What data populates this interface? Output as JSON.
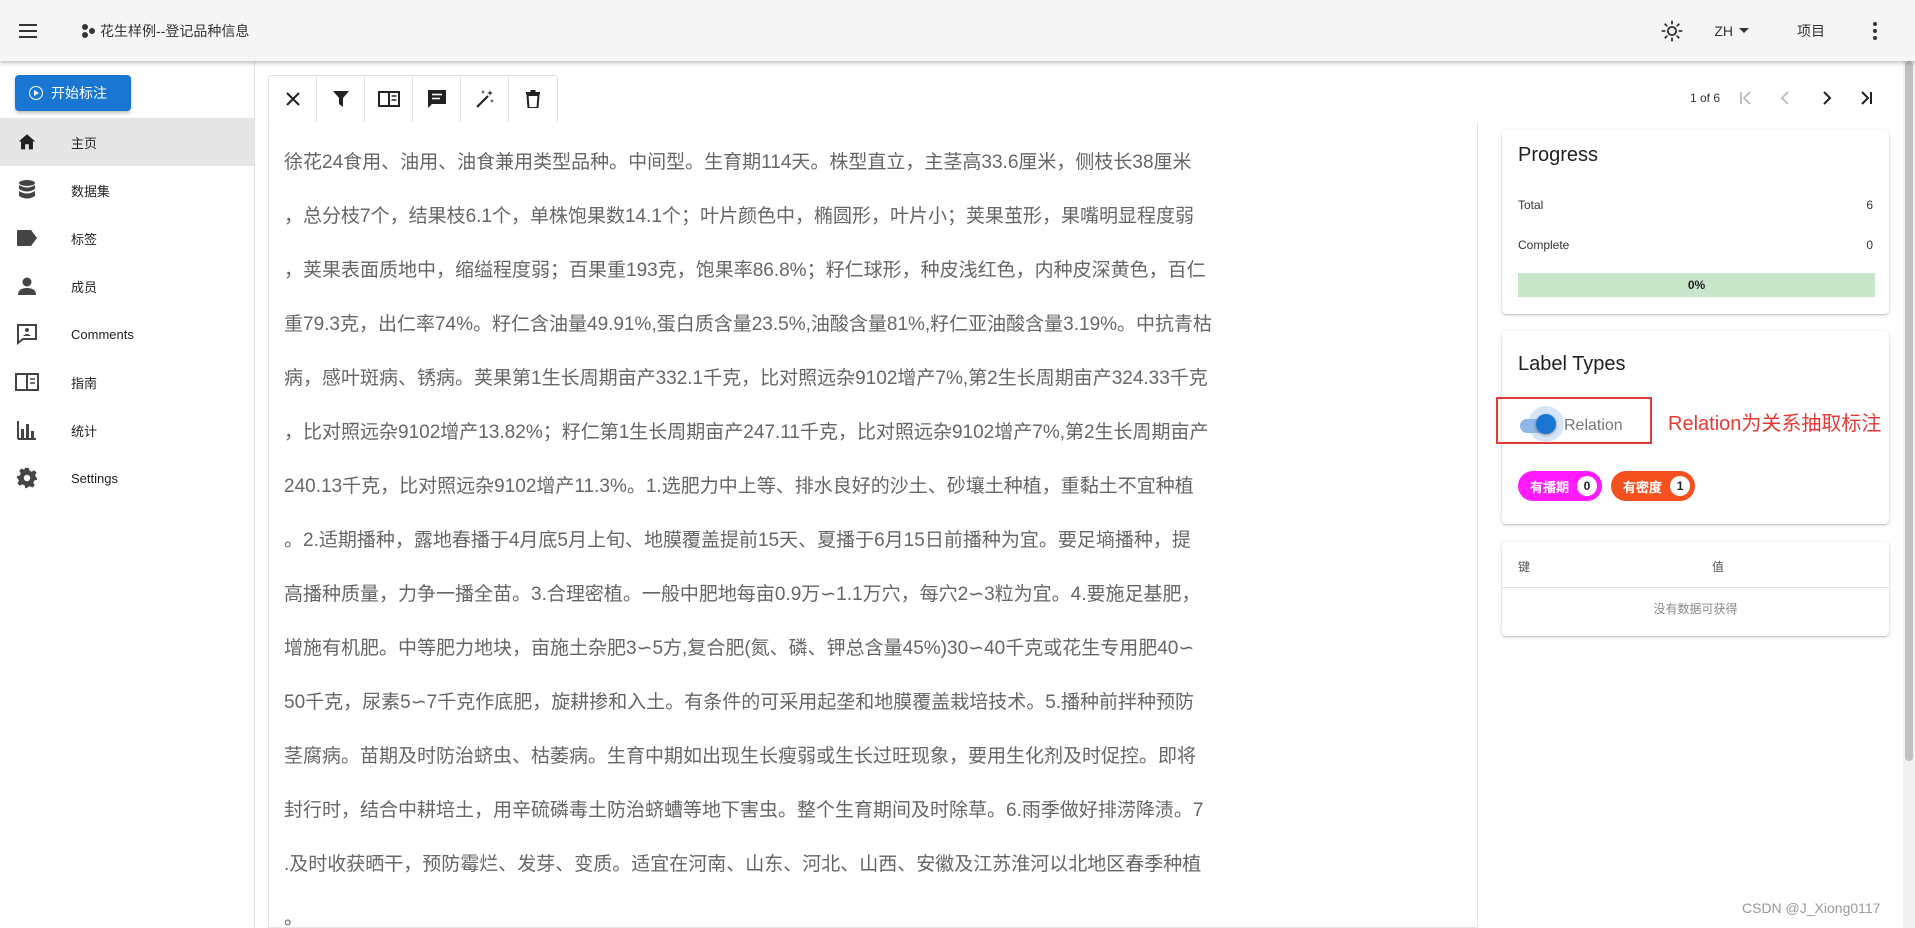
{
  "appbar": {
    "title": "花生样例--登记品种信息",
    "lang": "ZH",
    "projects_label": "项目"
  },
  "sidebar": {
    "start_label": "开始标注",
    "items": [
      {
        "label": "主页",
        "icon": "home-icon"
      },
      {
        "label": "数据集",
        "icon": "database-icon"
      },
      {
        "label": "标签",
        "icon": "label-icon"
      },
      {
        "label": "成员",
        "icon": "person-icon"
      },
      {
        "label": "Comments",
        "icon": "comment-icon"
      },
      {
        "label": "指南",
        "icon": "book-icon"
      },
      {
        "label": "统计",
        "icon": "bar-chart-icon"
      },
      {
        "label": "Settings",
        "icon": "gear-icon"
      }
    ]
  },
  "toolbar": {
    "buttons": [
      "close-icon",
      "filter-icon",
      "guideline-icon",
      "comment-icon",
      "auto-label-icon",
      "delete-icon"
    ]
  },
  "pager": {
    "text": "1 of 6"
  },
  "document": {
    "lines": [
      "徐花24食用、油用、油食兼用类型品种。中间型。生育期114天。株型直立，主茎高33.6厘米，侧枝长38厘米",
      "，总分枝7个，结果枝6.1个，单株饱果数14.1个；叶片颜色中，椭圆形，叶片小；荚果茧形，果嘴明显程度弱",
      "，荚果表面质地中，缩缢程度弱；百果重193克，饱果率86.8%；籽仁球形，种皮浅红色，内种皮深黄色，百仁",
      "重79.3克，出仁率74%。籽仁含油量49.91%,蛋白质含量23.5%,油酸含量81%,籽仁亚油酸含量3.19%。中抗青枯",
      "病，感叶斑病、锈病。荚果第1生长周期亩产332.1千克，比对照远杂9102增产7%,第2生长周期亩产324.33千克",
      "，比对照远杂9102增产13.82%；籽仁第1生长周期亩产247.11千克，比对照远杂9102增产7%,第2生长周期亩产",
      "240.13千克，比对照远杂9102增产11.3%。1.选肥力中上等、排水良好的沙土、砂壤土种植，重黏土不宜种植",
      "。2.适期播种，露地春播于4月底5月上旬、地膜覆盖提前15天、夏播于6月15日前播种为宜。要足墒播种，提",
      "高播种质量，力争一播全苗。3.合理密植。一般中肥地每亩0.9万∽1.1万穴，每穴2∽3粒为宜。4.要施足基肥，",
      "增施有机肥。中等肥力地块，亩施土杂肥3∽5方,复合肥(氮、磷、钾总含量45%)30∽40千克或花生专用肥40∽",
      "50千克，尿素5∽7千克作底肥，旋耕掺和入土。有条件的可采用起垄和地膜覆盖栽培技术。5.播种前拌种预防",
      "茎腐病。苗期及时防治蛴虫、枯萎病。生育中期如出现生长瘦弱或生长过旺现象，要用生化剂及时促控。即将",
      "封行时，结合中耕培土，用辛硫磷毒土防治蛴螬等地下害虫。整个生育期间及时除草。6.雨季做好排涝降渍。7",
      ".及时收获晒干，预防霉烂、发芽、变质。适宜在河南、山东、河北、山西、安徽及江苏淮河以北地区春季种植",
      "。"
    ]
  },
  "progress": {
    "title": "Progress",
    "total_label": "Total",
    "total_value": "6",
    "complete_label": "Complete",
    "complete_value": "0",
    "percent_text": "0%",
    "fraction": 0
  },
  "label_types": {
    "title": "Label Types",
    "switch_label": "Relation",
    "switch_on": true,
    "annotation": "Relation为关系抽取标注",
    "chips": [
      {
        "label": "有播期",
        "count": "0",
        "color": "#ff1aff"
      },
      {
        "label": "有密度",
        "count": "1",
        "color": "#f4511e"
      }
    ]
  },
  "kv_table": {
    "key_header": "键",
    "value_header": "值",
    "empty_text": "没有数据可获得"
  },
  "watermark": "CSDN @J_Xiong0117",
  "colors": {
    "primary": "#1976d2",
    "annotation_red": "#e53935",
    "progress_bg": "#c8e6c9"
  }
}
